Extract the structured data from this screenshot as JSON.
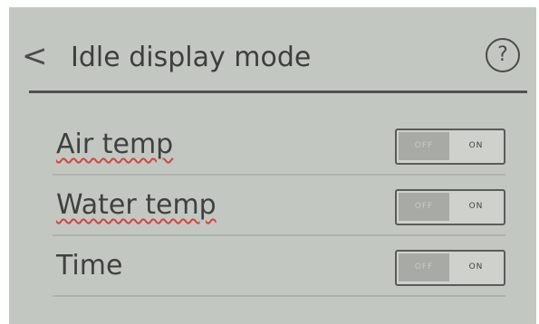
{
  "header": {
    "back_glyph": "<",
    "title": "Idle display mode",
    "help_glyph": "?"
  },
  "settings": [
    {
      "label": "Air temp",
      "off_label": "OFF",
      "on_label": "ON",
      "state": "off"
    },
    {
      "label": "Water temp",
      "off_label": "OFF",
      "on_label": "ON",
      "state": "off"
    },
    {
      "label": "Time",
      "off_label": "OFF",
      "on_label": "ON",
      "state": "off"
    }
  ]
}
